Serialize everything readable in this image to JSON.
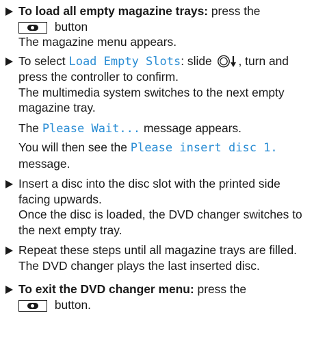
{
  "colors": {
    "display_text": "#2a8dd4",
    "text": "#1a1a1a"
  },
  "icons": {
    "bullet": "triangle-right",
    "media_button": "disc-button",
    "controller": "controller-slide-down"
  },
  "steps": [
    {
      "lead": "To load all empty magazine trays:",
      "text_a": " press the",
      "text_b": " button",
      "result": "The magazine menu appears."
    },
    {
      "text_a": "To select ",
      "display": "Load Empty Slots",
      "text_b": ": slide ",
      "text_c": ", turn and press the controller to confirm.",
      "result": "The multimedia system switches to the next empty magazine tray."
    },
    {
      "msg1_pre": "The ",
      "msg1_display": "Please Wait...",
      "msg1_post": " message appears.",
      "msg2_pre": "You will then see the ",
      "msg2_display": "Please insert disc 1.",
      "msg2_post": " message."
    },
    {
      "text": "Insert a disc into the disc slot with the printed side facing upwards.",
      "result": "Once the disc is loaded, the DVD changer switches to the next empty tray."
    },
    {
      "text": "Repeat these steps until all magazine trays are filled.",
      "result": "The DVD changer plays the last inserted disc."
    },
    {
      "lead": "To exit the DVD changer menu:",
      "text_a": " press the",
      "text_b": " button."
    }
  ]
}
